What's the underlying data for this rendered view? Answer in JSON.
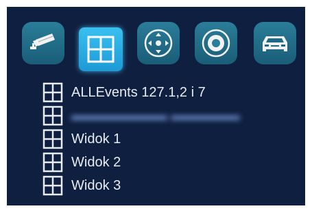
{
  "toolbar": {
    "buttons": [
      {
        "icon": "camera-icon",
        "active": false
      },
      {
        "icon": "grid-layout-icon",
        "active": true
      },
      {
        "icon": "ptz-control-icon",
        "active": false
      },
      {
        "icon": "record-icon",
        "active": false
      },
      {
        "icon": "car-icon",
        "active": false
      }
    ]
  },
  "views": {
    "items": [
      {
        "label": "ALLEvents 127.1,2 i 7",
        "obscured": false
      },
      {
        "label": "",
        "obscured": true
      },
      {
        "label": "Widok 1",
        "obscured": false
      },
      {
        "label": "Widok 2",
        "obscured": false
      },
      {
        "label": "Widok 3",
        "obscured": false
      }
    ],
    "icon": "grid-view-icon"
  },
  "colors": {
    "background": "#0f1f3f",
    "button": "#1f6a86",
    "button_active": "#2cb0e6",
    "text": "#e8ecf2"
  }
}
